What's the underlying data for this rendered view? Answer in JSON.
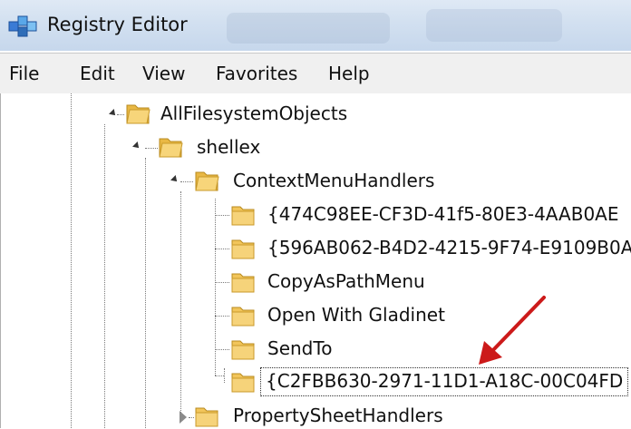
{
  "window": {
    "title": "Registry Editor"
  },
  "menu": [
    "File",
    "Edit",
    "View",
    "Favorites",
    "Help"
  ],
  "tree": {
    "all_filesystem_objects": "AllFilesystemObjects",
    "shellex": "shellex",
    "context_menu_handlers": "ContextMenuHandlers",
    "children": [
      "{474C98EE-CF3D-41f5-80E3-4AAB0AE",
      "{596AB062-B4D2-4215-9F74-E9109B0A",
      "CopyAsPathMenu",
      "Open With Gladinet",
      "SendTo",
      "{C2FBB630-2971-11D1-A18C-00C04FD"
    ],
    "property_sheet_handlers": "PropertySheetHandlers"
  },
  "colors": {
    "arrow": "#cc1a1a",
    "folder": "#f2c55a"
  }
}
